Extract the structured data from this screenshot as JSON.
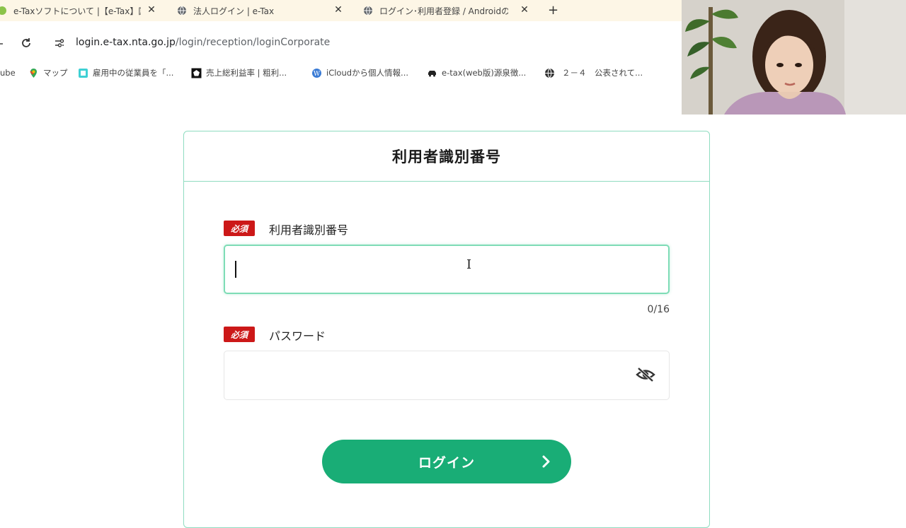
{
  "browser": {
    "tabs": [
      {
        "title": "e-Taxソフトについて |【e-Tax】国税",
        "active": false
      },
      {
        "title": "法人ログイン | e-Tax",
        "active": true
      },
      {
        "title": "ログイン･利用者登録 / Androidの",
        "active": false
      }
    ],
    "new_tab": "+",
    "url_host": "login.e-tax.nta.go.jp",
    "url_path": "/login/reception/loginCorporate",
    "bookmarks": [
      {
        "label": "ube",
        "icon": "youtube-icon"
      },
      {
        "label": "マップ",
        "icon": "maps-icon"
      },
      {
        "label": "雇用中の従業員を「...",
        "icon": "page-icon"
      },
      {
        "label": "売上総利益率 | 粗利...",
        "icon": "pentagon-icon"
      },
      {
        "label": "iCloudから個人情報...",
        "icon": "wordpress-icon"
      },
      {
        "label": "e-tax(web版)源泉徴...",
        "icon": "car-icon"
      },
      {
        "label": "２－４　公表されて...",
        "icon": "globe-icon"
      }
    ]
  },
  "form": {
    "card_title": "利用者識別番号",
    "required_badge": "必須",
    "user_id_label": "利用者識別番号",
    "user_id_value": "",
    "user_id_counter": "0/16",
    "password_label": "パスワード",
    "password_value": "",
    "login_button": "ログイン"
  },
  "colors": {
    "accent": "#19ad76",
    "border": "#8fdcc0",
    "required": "#cc1818"
  }
}
